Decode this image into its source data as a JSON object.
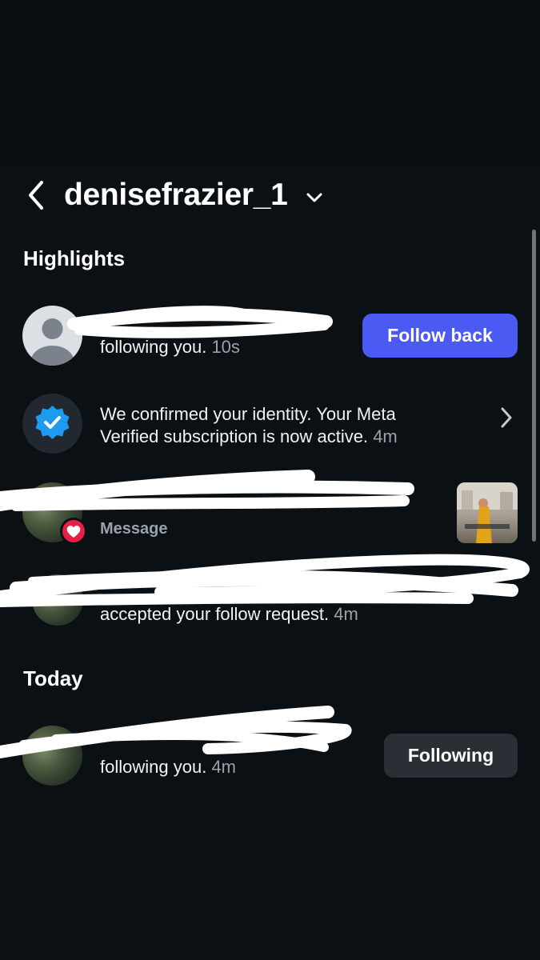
{
  "header": {
    "username": "denisefrazier_1",
    "back_icon": "chevron-left-icon",
    "dropdown_icon": "chevron-down-icon"
  },
  "sections": {
    "highlights_title": "Highlights",
    "today_title": "Today"
  },
  "highlights": [
    {
      "text": "following you.",
      "time": "10s",
      "button": "Follow back"
    },
    {
      "text_line1": "We confirmed your identity. Your Meta",
      "text_line2": "Verified subscription is now active.",
      "time": "4m"
    },
    {
      "subtext": "Message"
    },
    {
      "text": "accepted your follow request.",
      "time": "4m"
    }
  ],
  "today": [
    {
      "text": "following you.",
      "time": "4m",
      "button": "Following"
    }
  ],
  "colors": {
    "background": "#0b1015",
    "primary_button": "#4a5af2",
    "secondary_button": "#2a2f36",
    "verified_blue": "#1d9bf0",
    "like_red": "#e62045"
  }
}
